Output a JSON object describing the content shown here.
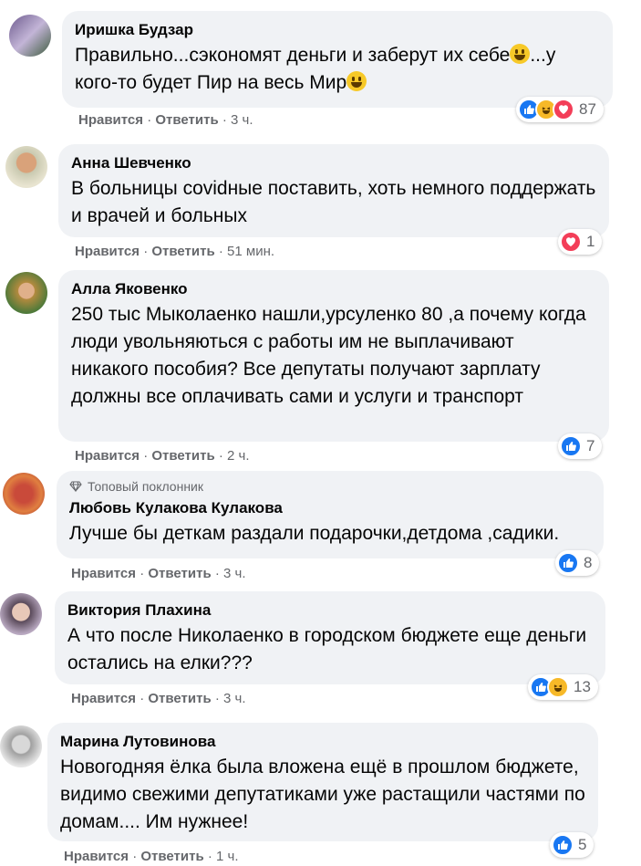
{
  "comments": [
    {
      "author": "Иришка Будзар",
      "text_a": "Правильно...сэкономят деньги и заберут их себе",
      "text_b": "...у кого-то будет Пир на весь Мир",
      "actions": {
        "like": "Нравится",
        "reply": "Ответить",
        "time": "3 ч."
      },
      "reaction_count": "87",
      "reactions": [
        "like",
        "haha",
        "love"
      ]
    },
    {
      "author": "Анна Шевченко",
      "text": "В больницы covidные поставить, хоть немного поддержать и врачей и больных",
      "actions": {
        "like": "Нравится",
        "reply": "Ответить",
        "time": "51 мин."
      },
      "reaction_count": "1",
      "reactions": [
        "love"
      ]
    },
    {
      "author": "Алла Яковенко",
      "text": "250 тыс Мыколаенко нашли,урсуленко 80 ,а почему когда люди увольняються с работы им не выплачивают никакого пособия? Все депутаты получают зарплату должны все оплачивать сами и услуги и транспорт",
      "actions": {
        "like": "Нравится",
        "reply": "Ответить",
        "time": "2 ч."
      },
      "reaction_count": "7",
      "reactions": [
        "like"
      ]
    },
    {
      "badge": "Топовый поклонник",
      "author": "Любовь Кулакова Кулакова",
      "text": "Лучше бы деткам раздали подарочки,детдома ,садики.",
      "actions": {
        "like": "Нравится",
        "reply": "Ответить",
        "time": "3 ч."
      },
      "reaction_count": "8",
      "reactions": [
        "like"
      ]
    },
    {
      "author": "Виктория Плахина",
      "text": "А что после Николаенко в городском бюджете еще деньги остались на елки???",
      "actions": {
        "like": "Нравится",
        "reply": "Ответить",
        "time": "3 ч."
      },
      "reaction_count": "13",
      "reactions": [
        "like",
        "haha"
      ]
    },
    {
      "author": "Марина Лутовинова",
      "text": "Новогодняя ёлка была вложена ещё в прошлом бюджете, видимо свежими депутатиками уже растащили частями по домам.... Им нужнее!",
      "actions": {
        "like": "Нравится",
        "reply": "Ответить",
        "time": "1 ч."
      },
      "reaction_count": "5",
      "reactions": [
        "like"
      ]
    }
  ],
  "colors": {
    "bubble": "#f0f2f5",
    "like": "#1877f2",
    "haha": "#f7b928",
    "love": "#f33e58",
    "meta": "#65676b"
  }
}
